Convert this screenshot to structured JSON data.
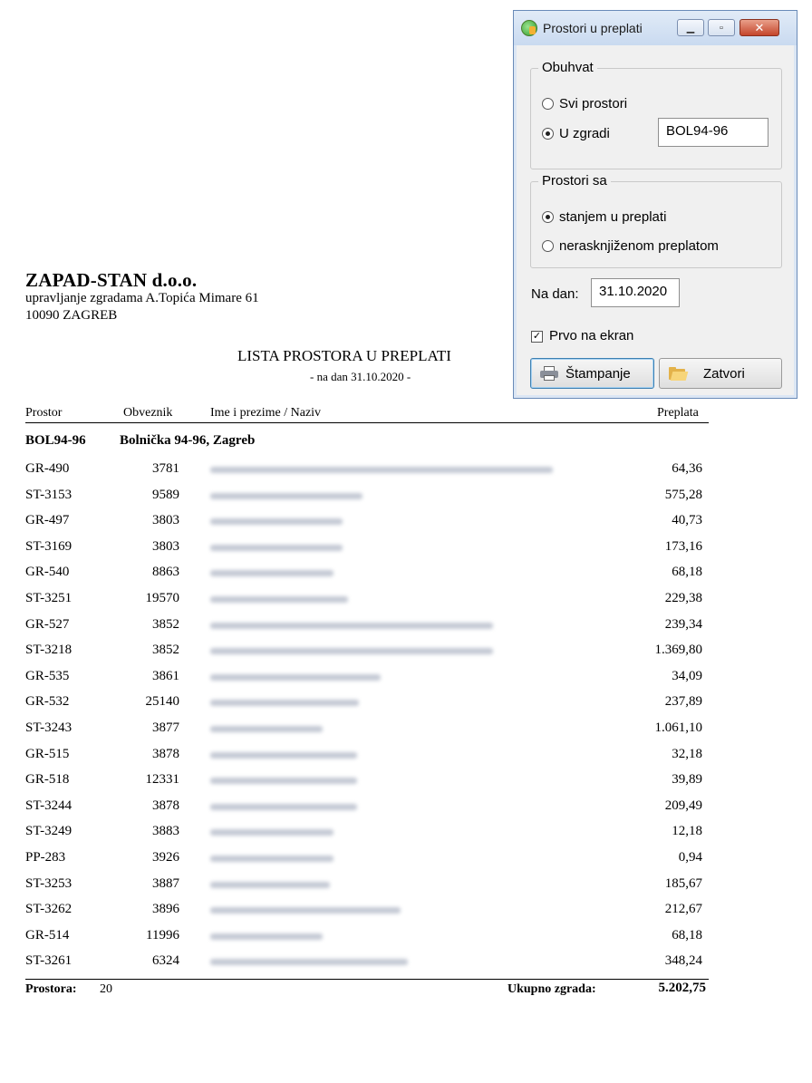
{
  "report": {
    "company_name": "ZAPAD-STAN d.o.o.",
    "company_line1": "upravljanje zgradama A.Topića Mimare 61",
    "company_line2": "10090 ZAGREB",
    "title": "LISTA PROSTORA U PREPLATI",
    "subtitle": "- na dan 31.10.2020 -",
    "columns": {
      "prostor": "Prostor",
      "obveznik": "Obveznik",
      "naziv": "Ime i prezime / Naziv",
      "preplata": "Preplata"
    },
    "group": {
      "code": "BOL94-96",
      "name": "Bolnička 94-96, Zagreb"
    },
    "rows": [
      {
        "code": "GR-490",
        "obveznik": "3781",
        "preplata": "64,36"
      },
      {
        "code": "ST-3153",
        "obveznik": "9589",
        "preplata": "575,28"
      },
      {
        "code": "GR-497",
        "obveznik": "3803",
        "preplata": "40,73"
      },
      {
        "code": "ST-3169",
        "obveznik": "3803",
        "preplata": "173,16"
      },
      {
        "code": "GR-540",
        "obveznik": "8863",
        "preplata": "68,18"
      },
      {
        "code": "ST-3251",
        "obveznik": "19570",
        "preplata": "229,38"
      },
      {
        "code": "GR-527",
        "obveznik": "3852",
        "preplata": "239,34"
      },
      {
        "code": "ST-3218",
        "obveznik": "3852",
        "preplata": "1.369,80"
      },
      {
        "code": "GR-535",
        "obveznik": "3861",
        "preplata": "34,09"
      },
      {
        "code": "GR-532",
        "obveznik": "25140",
        "preplata": "237,89"
      },
      {
        "code": "ST-3243",
        "obveznik": "3877",
        "preplata": "1.061,10"
      },
      {
        "code": "GR-515",
        "obveznik": "3878",
        "preplata": "32,18"
      },
      {
        "code": "GR-518",
        "obveznik": "12331",
        "preplata": "39,89"
      },
      {
        "code": "ST-3244",
        "obveznik": "3878",
        "preplata": "209,49"
      },
      {
        "code": "ST-3249",
        "obveznik": "3883",
        "preplata": "12,18"
      },
      {
        "code": "PP-283",
        "obveznik": "3926",
        "preplata": "0,94"
      },
      {
        "code": "ST-3253",
        "obveznik": "3887",
        "preplata": "185,67"
      },
      {
        "code": "ST-3262",
        "obveznik": "3896",
        "preplata": "212,67"
      },
      {
        "code": "GR-514",
        "obveznik": "11996",
        "preplata": "68,18"
      },
      {
        "code": "ST-3261",
        "obveznik": "6324",
        "preplata": "348,24"
      }
    ],
    "footer": {
      "count_label": "Prostora:",
      "count": "20",
      "total_label": "Ukupno zgrada:",
      "total": "5.202,75"
    }
  },
  "dialog": {
    "title": "Prostori u preplati",
    "obuhvat": {
      "legend": "Obuhvat",
      "option_all": "Svi prostori",
      "option_building": "U zgradi",
      "selected": "option_building",
      "building_value": "BOL94-96"
    },
    "prostori_sa": {
      "legend": "Prostori sa",
      "option_state": "stanjem u preplati",
      "option_unposted": "nerasknjiženom preplatom",
      "selected": "option_state"
    },
    "na_dan_label": "Na dan:",
    "na_dan_value": "31.10.2020",
    "prvo_na_ekran_label": "Prvo na ekran",
    "prvo_na_ekran_checked": true,
    "print_button": "Štampanje",
    "close_button": "Zatvori"
  }
}
